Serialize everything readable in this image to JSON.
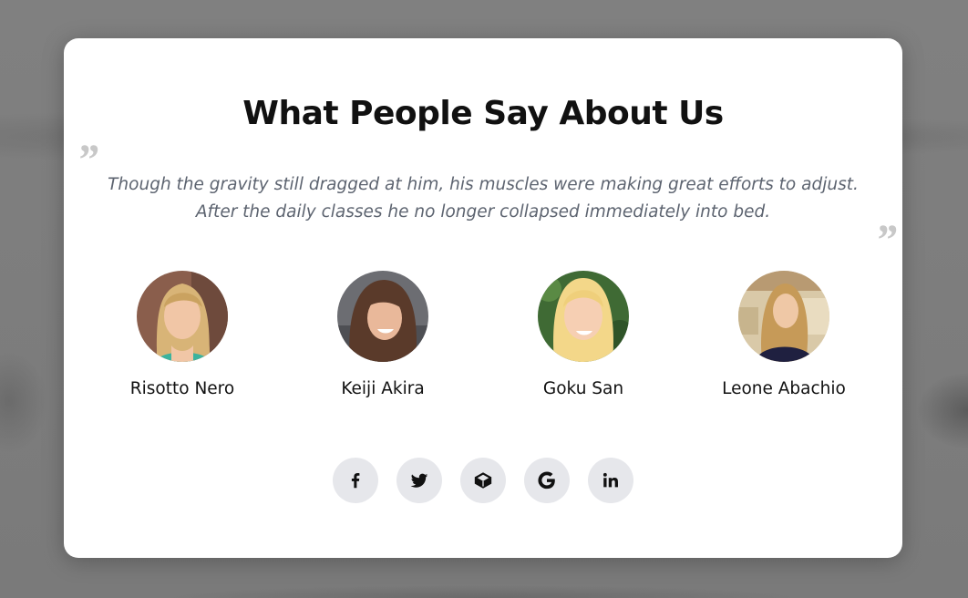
{
  "modal": {
    "title": "What People Say About Us",
    "quote": "Though the gravity still dragged at him, his muscles were making great efforts to adjust. After the daily classes he no longer collapsed immediately into bed.",
    "quote_open_mark": "”",
    "quote_close_mark": "”"
  },
  "people": [
    {
      "name": "Risotto Nero"
    },
    {
      "name": "Keiji Akira"
    },
    {
      "name": "Goku San"
    },
    {
      "name": "Leone Abachio"
    }
  ],
  "socials": [
    {
      "icon": "facebook-icon"
    },
    {
      "icon": "twitter-icon"
    },
    {
      "icon": "codepen-icon"
    },
    {
      "icon": "google-icon"
    },
    {
      "icon": "linkedin-icon"
    }
  ],
  "colors": {
    "backdrop": "#7b7b7b",
    "modal_bg": "#ffffff",
    "quote_text": "#5d6470",
    "quote_mark": "#c8c8c8",
    "social_bg": "#e6e7eb"
  }
}
